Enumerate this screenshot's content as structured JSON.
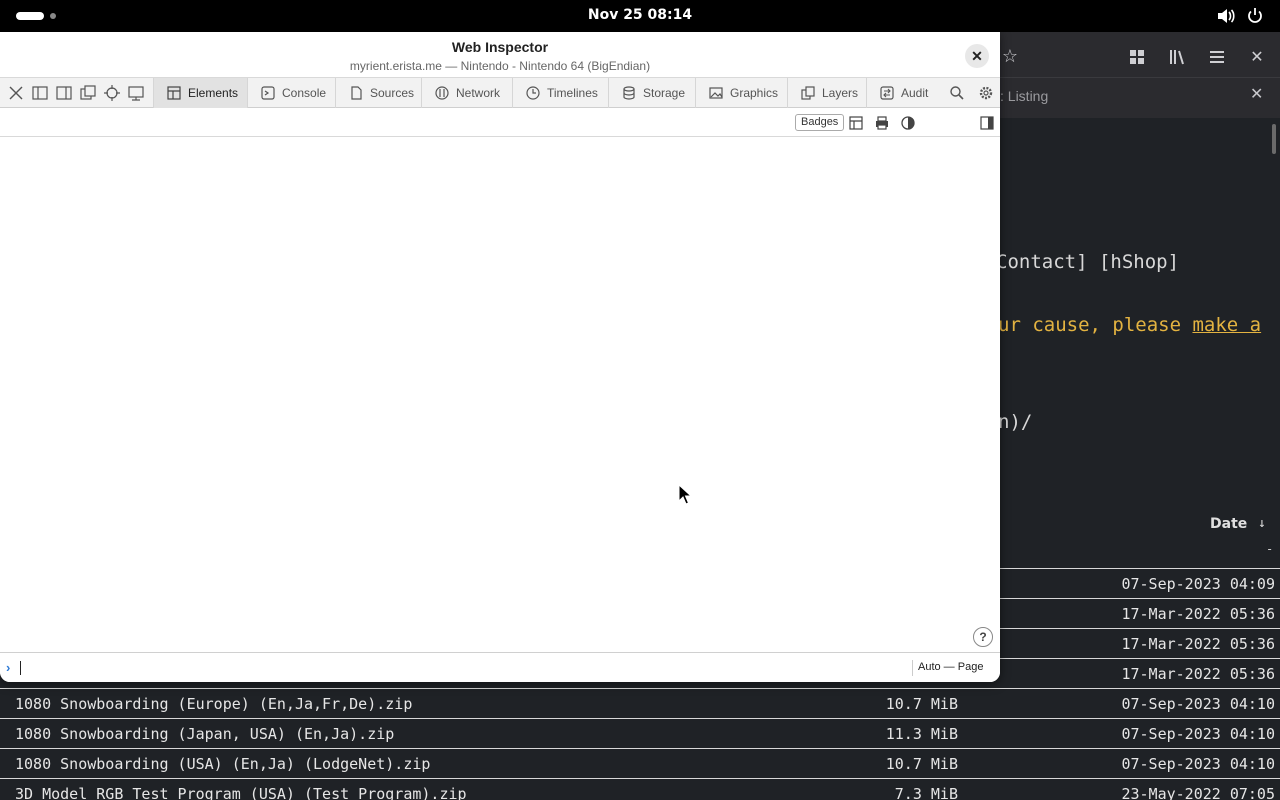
{
  "topbar": {
    "clock": "Nov 25  08:14"
  },
  "browser": {
    "tab_title": ": Listing",
    "content": {
      "line1": "Contact] [hShop]",
      "line2_text": "ur cause, please ",
      "line2_link": "make a",
      "line3": "n)/",
      "date_header": "Date",
      "date_sort_arrow": "↓",
      "dash": "-"
    },
    "rows": [
      {
        "name": "",
        "size": "",
        "date": "07-Sep-2023 04:09"
      },
      {
        "name": "",
        "size": "",
        "date": "17-Mar-2022 05:36"
      },
      {
        "name": "",
        "size": "",
        "date": "17-Mar-2022 05:36"
      },
      {
        "name": "",
        "size": "",
        "date": "17-Mar-2022 05:36"
      },
      {
        "name": "1080 Snowboarding (Europe) (En,Ja,Fr,De).zip",
        "size": "10.7 MiB",
        "date": "07-Sep-2023 04:10"
      },
      {
        "name": "1080 Snowboarding (Japan, USA) (En,Ja).zip",
        "size": "11.3 MiB",
        "date": "07-Sep-2023 04:10"
      },
      {
        "name": "1080 Snowboarding (USA) (En,Ja) (LodgeNet).zip",
        "size": "10.7 MiB",
        "date": "07-Sep-2023 04:10"
      },
      {
        "name": "3D Model RGB Test Program (USA) (Test Program).zip",
        "size": "7.3 MiB",
        "date": "23-May-2022 07:05"
      }
    ]
  },
  "inspector": {
    "title": "Web Inspector",
    "subtitle": "myrient.erista.me — Nintendo - Nintendo 64 (BigEndian)",
    "tabs": [
      "Elements",
      "Console",
      "Sources",
      "Network",
      "Timelines",
      "Storage",
      "Graphics",
      "Layers",
      "Audit"
    ],
    "badges_label": "Badges",
    "help_label": "?",
    "console_prompt": "›",
    "console_context": "Auto — Page"
  }
}
